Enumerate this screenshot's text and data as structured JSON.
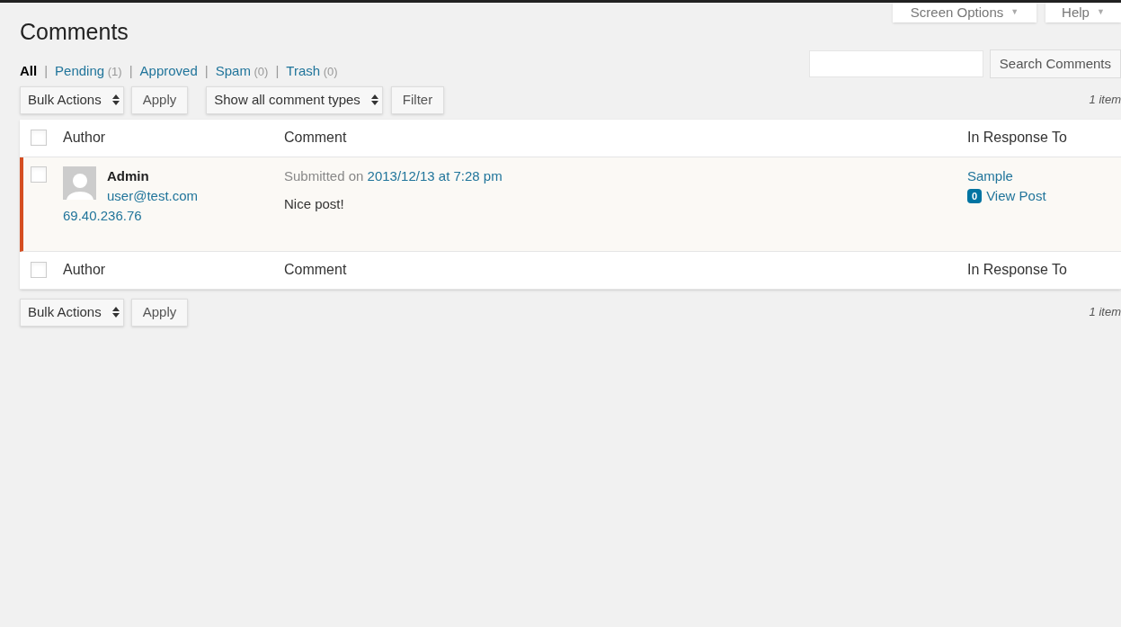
{
  "screen_meta": [
    {
      "label": "Screen Options",
      "arrow": "▼"
    },
    {
      "label": "Help",
      "arrow": "▼"
    }
  ],
  "page_title": "Comments",
  "filters": [
    {
      "label": "All",
      "selected": true
    },
    {
      "separator": "|",
      "label": "Pending",
      "count": "(1)",
      "selected": false
    },
    {
      "separator": "|",
      "label": "Approved",
      "selected": false
    },
    {
      "separator": "|",
      "label": "Spam",
      "count": "(0)",
      "selected": false
    },
    {
      "separator": "|",
      "label": "Trash",
      "count": "(0)",
      "selected": false
    }
  ],
  "search": {
    "button": "Search Comments"
  },
  "top_nav": {
    "bulk_select": "Bulk Actions",
    "apply": "Apply",
    "type_select": "Show all comment types",
    "filter": "Filter",
    "count": "1 item"
  },
  "table": {
    "columns": [
      "Author",
      "Comment",
      "In Response To"
    ],
    "footer_columns": [
      "Author",
      "Comment",
      "In Response To"
    ],
    "header_checked": false,
    "footer_checked": false,
    "rows": [
      {
        "checked": false,
        "unapproved": true,
        "author": "Admin",
        "email": "user@test.com",
        "ip": "69.40.236.76",
        "submitted_prefix": "Submitted on",
        "submitted_date": "2013/12/13 at 7:28 pm",
        "comment": "Nice post!",
        "post": "Sample",
        "post_comments": "0",
        "view_post": "View Post"
      }
    ]
  },
  "bottom_nav": {
    "bulk_select": "Bulk Actions",
    "apply": "Apply",
    "count": "1 item"
  }
}
